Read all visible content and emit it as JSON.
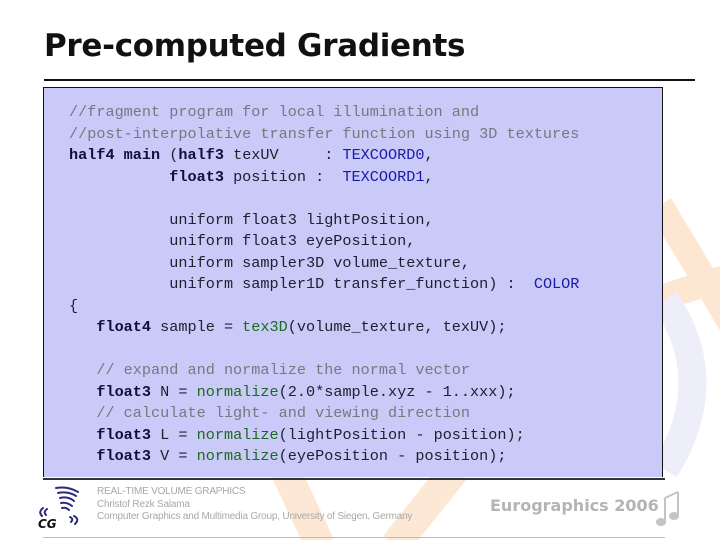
{
  "slide": {
    "title": "Pre-computed Gradients"
  },
  "code": {
    "lines": [
      [
        {
          "t": "//fragment program for local illumination and",
          "c": "comment"
        }
      ],
      [
        {
          "t": "//post-interpolative transfer function using 3D textures",
          "c": "comment"
        }
      ],
      [
        {
          "t": "half4 main ",
          "c": "kw"
        },
        {
          "t": "(",
          "c": "plain"
        },
        {
          "t": "half3",
          "c": "kw"
        },
        {
          "t": " texUV     : ",
          "c": "plain"
        },
        {
          "t": "TEXCOORD0",
          "c": "sem"
        },
        {
          "t": ",",
          "c": "plain"
        }
      ],
      [
        {
          "t": "           ",
          "c": "plain"
        },
        {
          "t": "float3",
          "c": "kw"
        },
        {
          "t": " position :  ",
          "c": "plain"
        },
        {
          "t": "TEXCOORD1",
          "c": "sem"
        },
        {
          "t": ",",
          "c": "plain"
        }
      ],
      [
        {
          "t": "",
          "c": "plain"
        }
      ],
      [
        {
          "t": "           uniform float3 lightPosition,",
          "c": "plain"
        }
      ],
      [
        {
          "t": "           uniform float3 eyePosition,",
          "c": "plain"
        }
      ],
      [
        {
          "t": "           uniform sampler3D volume_texture,",
          "c": "plain"
        }
      ],
      [
        {
          "t": "           uniform sampler1D transfer_function) :  ",
          "c": "plain"
        },
        {
          "t": "COLOR",
          "c": "sem"
        }
      ],
      [
        {
          "t": "{",
          "c": "plain"
        }
      ],
      [
        {
          "t": "   ",
          "c": "plain"
        },
        {
          "t": "float4",
          "c": "kw"
        },
        {
          "t": " sample = ",
          "c": "plain"
        },
        {
          "t": "tex3D",
          "c": "fn"
        },
        {
          "t": "(volume_texture, texUV);",
          "c": "plain"
        }
      ],
      [
        {
          "t": "",
          "c": "plain"
        }
      ],
      [
        {
          "t": "   // expand and normalize the normal vector",
          "c": "comment"
        }
      ],
      [
        {
          "t": "   ",
          "c": "plain"
        },
        {
          "t": "float3",
          "c": "kw"
        },
        {
          "t": " N = ",
          "c": "plain"
        },
        {
          "t": "normalize",
          "c": "fn"
        },
        {
          "t": "(2.0*sample.xyz - 1..xxx);",
          "c": "plain"
        }
      ],
      [
        {
          "t": "   // calculate light- and viewing direction",
          "c": "comment"
        }
      ],
      [
        {
          "t": "   ",
          "c": "plain"
        },
        {
          "t": "float3",
          "c": "kw"
        },
        {
          "t": " L = ",
          "c": "plain"
        },
        {
          "t": "normalize",
          "c": "fn"
        },
        {
          "t": "(lightPosition - position);",
          "c": "plain"
        }
      ],
      [
        {
          "t": "   ",
          "c": "plain"
        },
        {
          "t": "float3",
          "c": "kw"
        },
        {
          "t": " V = ",
          "c": "plain"
        },
        {
          "t": "normalize",
          "c": "fn"
        },
        {
          "t": "(eyePosition - position);",
          "c": "plain"
        }
      ]
    ]
  },
  "footer": {
    "logo_text": "CG",
    "line1": "REAL-TIME VOLUME GRAPHICS",
    "line2": "Christof Rezk Salama",
    "line3": "Computer Graphics and Multimedia Group, University of Siegen, Germany",
    "conference": "Eurographics 2006",
    "logo_icon": "cg-tornado-logo",
    "conference_icon": "music-note-icon"
  },
  "colors": {
    "code_background": "#cacaf8",
    "comment": "#777780",
    "keyword": "#101040",
    "semantic": "#1a1aa8",
    "function": "#1c6a1c",
    "footer_text": "#a8a8a8",
    "decoration": "#fde3cc"
  }
}
